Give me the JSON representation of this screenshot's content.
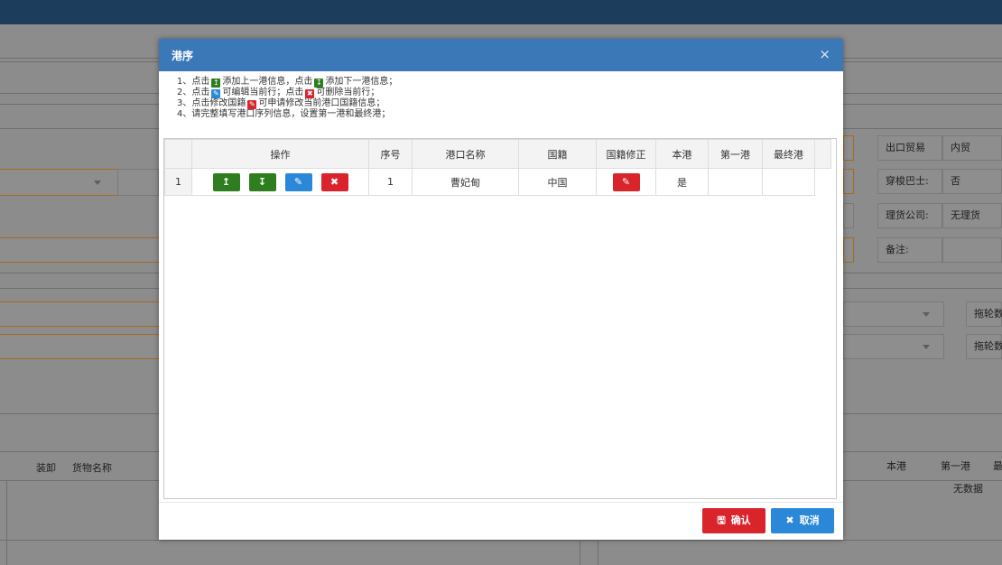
{
  "background": {
    "right_fields": [
      {
        "label": "出口贸易",
        "value": "内贸"
      },
      {
        "label": "穿梭巴士:",
        "value": "否"
      },
      {
        "label": "理货公司:",
        "value": "无理货"
      },
      {
        "label": "备注:",
        "value": ""
      }
    ],
    "right_buttons": [
      "拖轮数",
      "拖轮数"
    ],
    "table_headers_left": [
      "装卸",
      "货物名称"
    ],
    "table_headers_right": [
      "本港",
      "第一港",
      "最"
    ],
    "empty_text": "无数据"
  },
  "modal": {
    "title": "港序",
    "close_icon": "×",
    "instructions": {
      "line1_a": "1、点击",
      "line1_b": "添加上一港信息，点击",
      "line1_c": "添加下一港信息；",
      "line2_a": "2、点击",
      "line2_b": "可编辑当前行；点击",
      "line2_c": "可删除当前行；",
      "line3_a": "3、点击修改国籍",
      "line3_b": "可申请修改当前港口国籍信息；",
      "line4": "4、请完整填写港口序列信息，设置第一港和最终港；"
    },
    "columns": [
      "操作",
      "序号",
      "港口名称",
      "国籍",
      "国籍修正",
      "本港",
      "第一港",
      "最终港"
    ],
    "rows": [
      {
        "rownum": "1",
        "seq": "1",
        "port": "曹妃甸",
        "nationality": "中国",
        "is_local": "是",
        "first": "",
        "last": ""
      }
    ],
    "confirm_label": "确认",
    "cancel_label": "取消"
  },
  "colors": {
    "header": "#3b78b8",
    "green": "#2e7d1e",
    "blue": "#2b87d8",
    "red": "#d9242c"
  }
}
